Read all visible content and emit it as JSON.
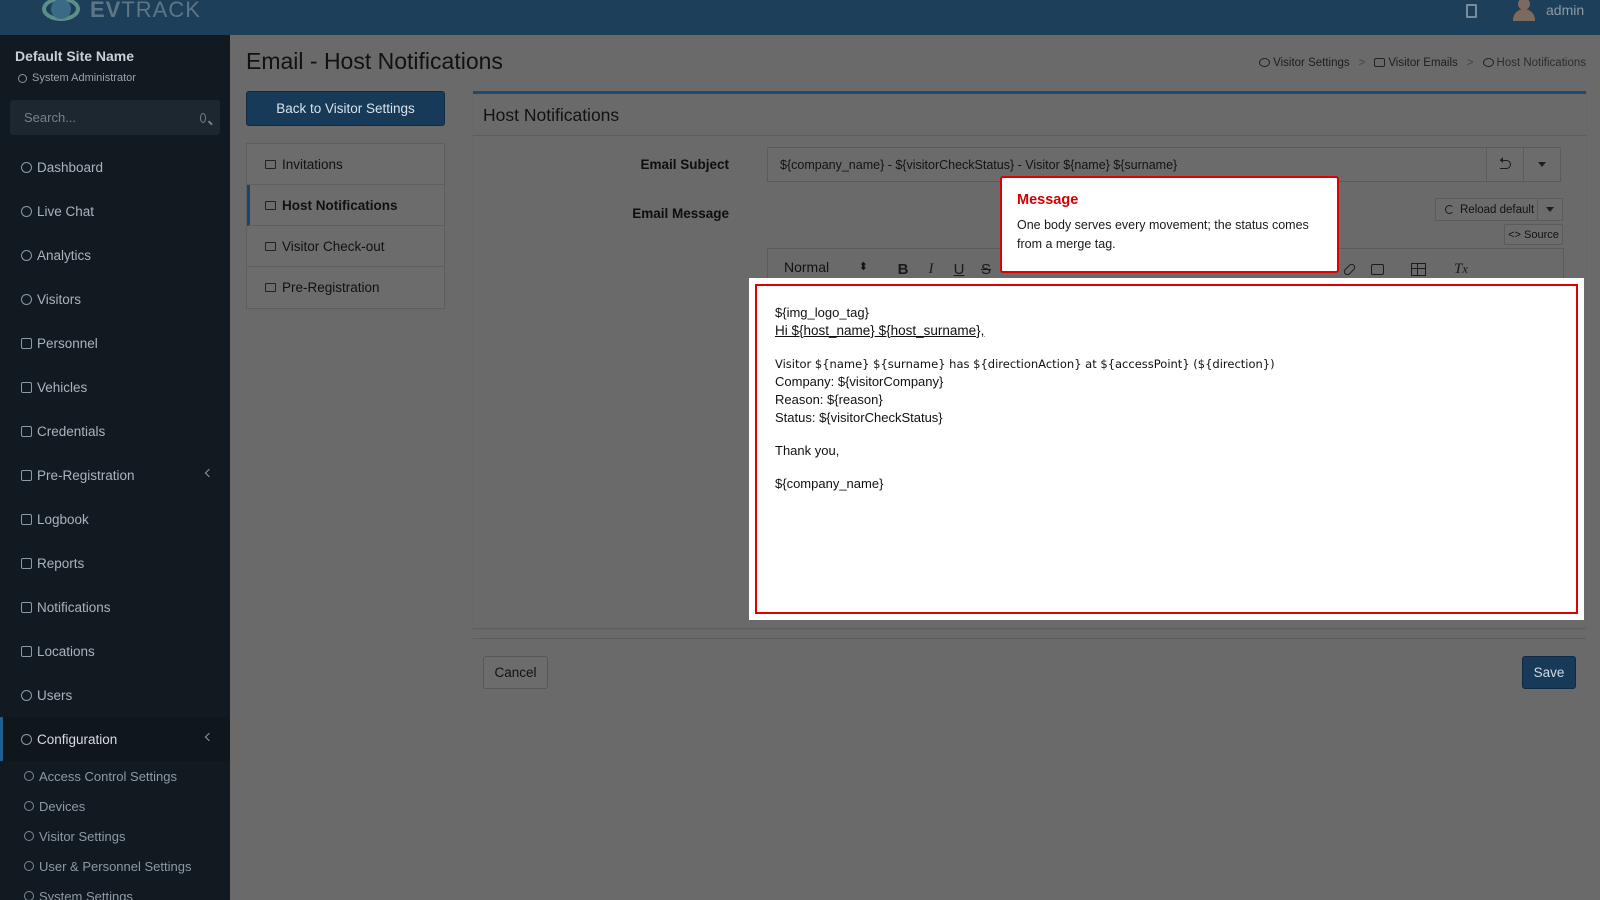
{
  "brand": {
    "logo_text_bold": "EV",
    "logo_text": "TRACK"
  },
  "topbar": {
    "user": "admin"
  },
  "sidebar": {
    "site_name": "Default Site Name",
    "role": "System Administrator",
    "search_placeholder": "Search...",
    "items": [
      {
        "label": "Dashboard"
      },
      {
        "label": "Live Chat"
      },
      {
        "label": "Analytics"
      },
      {
        "label": "Visitors"
      },
      {
        "label": "Personnel"
      },
      {
        "label": "Vehicles"
      },
      {
        "label": "Credentials"
      },
      {
        "label": "Pre-Registration"
      },
      {
        "label": "Logbook"
      },
      {
        "label": "Reports"
      },
      {
        "label": "Notifications"
      },
      {
        "label": "Locations"
      },
      {
        "label": "Users"
      },
      {
        "label": "Configuration"
      }
    ],
    "config_sub": [
      {
        "label": "Access Control Settings"
      },
      {
        "label": "Devices"
      },
      {
        "label": "Visitor Settings"
      },
      {
        "label": "User & Personnel Settings"
      },
      {
        "label": "System Settings"
      }
    ]
  },
  "page": {
    "title": "Email - Host Notifications",
    "breadcrumb": [
      "Visitor Settings",
      "Visitor Emails",
      "Host Notifications"
    ],
    "back_button": "Back to Visitor Settings"
  },
  "subnav": [
    {
      "label": "Invitations"
    },
    {
      "label": "Host Notifications"
    },
    {
      "label": "Visitor Check-out"
    },
    {
      "label": "Pre-Registration"
    }
  ],
  "panel": {
    "title": "Host Notifications",
    "subject_label": "Email Subject",
    "subject_value": "${company_name} - ${visitorCheckStatus} - Visitor ${name} ${surname}",
    "message_label": "Email Message",
    "reload_default": "Reload default",
    "source": "<> Source",
    "format_select": "Normal"
  },
  "editor": {
    "lines": [
      "${img_logo_tag}",
      "Hi ${host_name} ${host_surname},",
      "Visitor ${name} ${surname} has ${directionAction} at ${accessPoint} (${direction})",
      "Company: ${visitorCompany}",
      "Reason: ${reason}",
      "Status: ${visitorCheckStatus}",
      "Thank you,",
      "${company_name}"
    ]
  },
  "callout": {
    "title": "Message",
    "body": "One body serves every movement; the status comes from a merge tag."
  },
  "footer": {
    "cancel": "Cancel",
    "save": "Save"
  },
  "colors": {
    "accent": "#1d4a6e",
    "highlight": "#e00000",
    "sidebar_bg": "#121a21"
  }
}
